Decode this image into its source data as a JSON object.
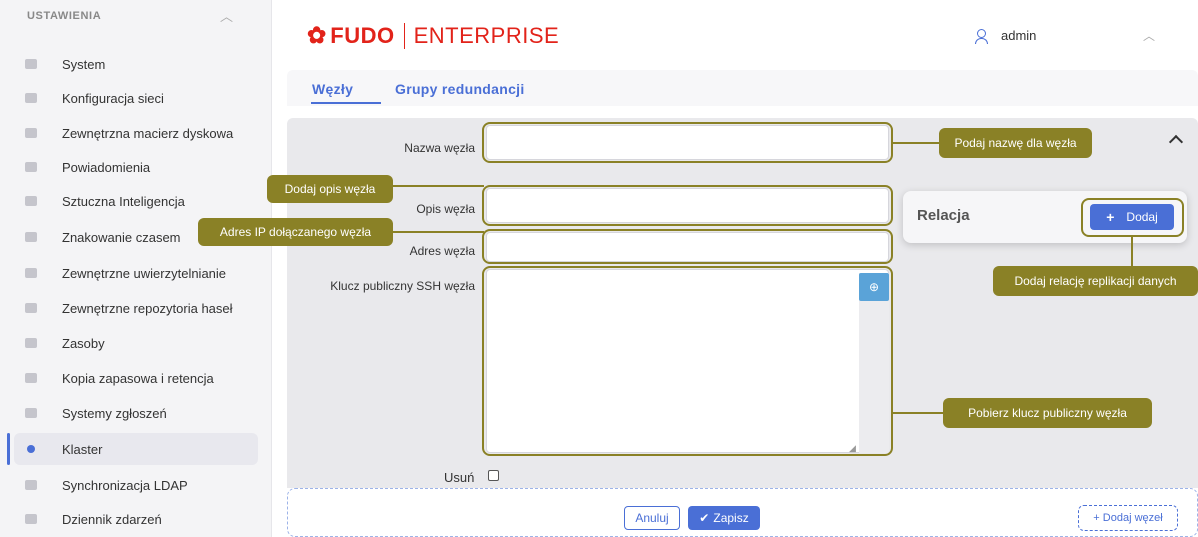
{
  "sidebar": {
    "header": "USTAWIENIA",
    "items": [
      {
        "label": "System"
      },
      {
        "label": "Konfiguracja sieci"
      },
      {
        "label": "Zewnętrzna macierz dyskowa"
      },
      {
        "label": "Powiadomienia"
      },
      {
        "label": "Sztuczna Inteligencja"
      },
      {
        "label": "Znakowanie czasem"
      },
      {
        "label": "Zewnętrzne uwierzytelnianie"
      },
      {
        "label": "Zewnętrzne repozytoria haseł"
      },
      {
        "label": "Zasoby"
      },
      {
        "label": "Kopia zapasowa i retencja"
      },
      {
        "label": "Systemy zgłoszeń"
      },
      {
        "label": "Klaster",
        "active": true
      },
      {
        "label": "Synchronizacja LDAP"
      },
      {
        "label": "Dziennik zdarzeń"
      }
    ]
  },
  "header": {
    "brand_name": "FUDO",
    "brand_edition": "ENTERPRISE",
    "user_name": "admin",
    "brand_color": "#e2231a"
  },
  "tabs": [
    {
      "label": "Węzły",
      "active": true
    },
    {
      "label": "Grupy redundancji"
    }
  ],
  "form": {
    "node_name_label": "Nazwa węzła",
    "node_desc_label": "Opis węzła",
    "node_address_label": "Adres węzła",
    "ssh_key_label": "Klucz publiczny SSH węzła",
    "delete_label": "Usuń"
  },
  "relation": {
    "title": "Relacja",
    "add_label": "Dodaj"
  },
  "actions": {
    "cancel_label": "Anuluj",
    "save_label": "Zapisz",
    "add_node_label": "+ Dodaj węzeł"
  },
  "annotations": {
    "node_name": "Podaj nazwę dla węzła",
    "node_desc": "Dodaj opis węzła",
    "node_ip": "Adres IP dołączanego węzła",
    "replication": "Dodaj relację replikacji danych",
    "ssh_key": "Pobierz klucz publiczny węzła"
  },
  "colors": {
    "accent": "#4a6fd6",
    "annotation": "#8a8126"
  }
}
